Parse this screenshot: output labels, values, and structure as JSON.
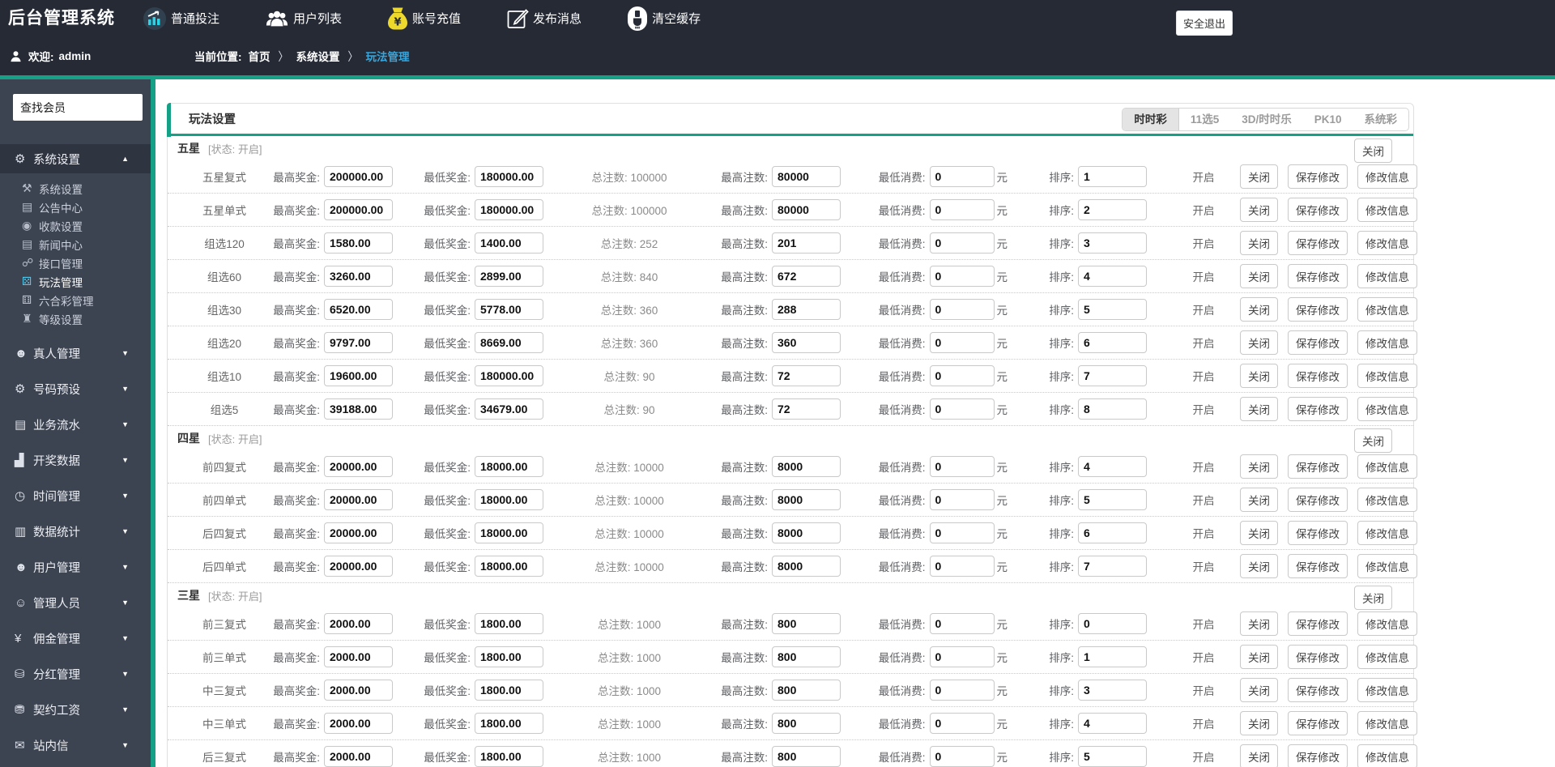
{
  "header": {
    "logo": "后台管理系统",
    "nav": [
      {
        "id": "bet",
        "label": "普通投注",
        "icon": "chart-circle-icon"
      },
      {
        "id": "users",
        "label": "用户列表",
        "icon": "users-icon"
      },
      {
        "id": "recharge",
        "label": "账号充值",
        "icon": "moneybag-icon"
      },
      {
        "id": "message",
        "label": "发布消息",
        "icon": "compose-icon"
      },
      {
        "id": "cache",
        "label": "清空缓存",
        "icon": "brush-icon"
      }
    ],
    "logout_label": "安全退出",
    "welcome_label": "欢迎:",
    "welcome_user": "admin",
    "breadcrumb": {
      "prefix": "当前位置:",
      "sep": "〉",
      "items": [
        "首页",
        "系统设置",
        "玩法管理"
      ]
    }
  },
  "sidebar": {
    "search_placeholder": "查找会员",
    "sections": [
      {
        "label": "系统设置",
        "glyph": "⚙",
        "icon": "gear-icon",
        "expanded": true,
        "children": [
          {
            "label": "系统设置",
            "glyph": "⚒",
            "icon": "wrench-icon"
          },
          {
            "label": "公告中心",
            "glyph": "▤",
            "icon": "notice-doc-icon"
          },
          {
            "label": "收款设置",
            "glyph": "◉",
            "icon": "payment-icon"
          },
          {
            "label": "新闻中心",
            "glyph": "▤",
            "icon": "news-doc-icon"
          },
          {
            "label": "接口管理",
            "glyph": "☍",
            "icon": "interface-icon"
          },
          {
            "label": "玩法管理",
            "glyph": "⚄",
            "icon": "gamepad-icon",
            "active": true
          },
          {
            "label": "六合彩管理",
            "glyph": "⚅",
            "icon": "lhc-gamepad-icon"
          },
          {
            "label": "等级设置",
            "glyph": "♜",
            "icon": "level-icon"
          }
        ]
      },
      {
        "label": "真人管理",
        "glyph": "☻",
        "icon": "live-person-icon"
      },
      {
        "label": "号码预设",
        "glyph": "⚙",
        "icon": "number-preset-icon"
      },
      {
        "label": "业务流水",
        "glyph": "▤",
        "icon": "ledger-icon"
      },
      {
        "label": "开奖数据",
        "glyph": "▟",
        "icon": "draw-data-icon"
      },
      {
        "label": "时间管理",
        "glyph": "◷",
        "icon": "clock-icon"
      },
      {
        "label": "数据统计",
        "glyph": "▥",
        "icon": "stats-icon"
      },
      {
        "label": "用户管理",
        "glyph": "☻",
        "icon": "user-group-icon"
      },
      {
        "label": "管理人员",
        "glyph": "☺",
        "icon": "admin-person-icon"
      },
      {
        "label": "佣金管理",
        "glyph": "¥",
        "icon": "commission-icon"
      },
      {
        "label": "分红管理",
        "glyph": "⛁",
        "icon": "dividend-icon"
      },
      {
        "label": "契约工资",
        "glyph": "⛃",
        "icon": "salary-icon"
      },
      {
        "label": "站内信",
        "glyph": "✉",
        "icon": "mail-icon"
      }
    ]
  },
  "panel": {
    "title": "玩法设置",
    "tabs": [
      {
        "label": "时时彩",
        "active": true
      },
      {
        "label": "11选5"
      },
      {
        "label": "3D/时时乐"
      },
      {
        "label": "PK10"
      },
      {
        "label": "系统彩"
      }
    ]
  },
  "table": {
    "labels": {
      "max_prize": "最高奖金:",
      "min_prize": "最低奖金:",
      "total_bets": "总注数:",
      "max_bets": "最高注数:",
      "min_cost": "最低消费:",
      "yuan": "元",
      "sort": "排序:",
      "status_on": "开启",
      "section_status": "[状态: 开启]",
      "btn_close": "关闭",
      "btn_save": "保存修改",
      "btn_edit": "修改信息"
    },
    "sections": [
      {
        "name": "五星",
        "rows": [
          {
            "name": "五星复式",
            "max_prize": "200000.00",
            "min_prize": "180000.00",
            "total": "100000",
            "max_bets": "80000",
            "min_cost": "0",
            "sort": "1"
          },
          {
            "name": "五星单式",
            "max_prize": "200000.00",
            "min_prize": "180000.00",
            "total": "100000",
            "max_bets": "80000",
            "min_cost": "0",
            "sort": "2"
          },
          {
            "name": "组选120",
            "max_prize": "1580.00",
            "min_prize": "1400.00",
            "total": "252",
            "max_bets": "201",
            "min_cost": "0",
            "sort": "3"
          },
          {
            "name": "组选60",
            "max_prize": "3260.00",
            "min_prize": "2899.00",
            "total": "840",
            "max_bets": "672",
            "min_cost": "0",
            "sort": "4"
          },
          {
            "name": "组选30",
            "max_prize": "6520.00",
            "min_prize": "5778.00",
            "total": "360",
            "max_bets": "288",
            "min_cost": "0",
            "sort": "5"
          },
          {
            "name": "组选20",
            "max_prize": "9797.00",
            "min_prize": "8669.00",
            "total": "360",
            "max_bets": "360",
            "min_cost": "0",
            "sort": "6"
          },
          {
            "name": "组选10",
            "max_prize": "19600.00",
            "min_prize": "180000.00",
            "total": "90",
            "max_bets": "72",
            "min_cost": "0",
            "sort": "7"
          },
          {
            "name": "组选5",
            "max_prize": "39188.00",
            "min_prize": "34679.00",
            "total": "90",
            "max_bets": "72",
            "min_cost": "0",
            "sort": "8"
          }
        ]
      },
      {
        "name": "四星",
        "rows": [
          {
            "name": "前四复式",
            "max_prize": "20000.00",
            "min_prize": "18000.00",
            "total": "10000",
            "max_bets": "8000",
            "min_cost": "0",
            "sort": "4"
          },
          {
            "name": "前四单式",
            "max_prize": "20000.00",
            "min_prize": "18000.00",
            "total": "10000",
            "max_bets": "8000",
            "min_cost": "0",
            "sort": "5"
          },
          {
            "name": "后四复式",
            "max_prize": "20000.00",
            "min_prize": "18000.00",
            "total": "10000",
            "max_bets": "8000",
            "min_cost": "0",
            "sort": "6"
          },
          {
            "name": "后四单式",
            "max_prize": "20000.00",
            "min_prize": "18000.00",
            "total": "10000",
            "max_bets": "8000",
            "min_cost": "0",
            "sort": "7"
          }
        ]
      },
      {
        "name": "三星",
        "rows": [
          {
            "name": "前三复式",
            "max_prize": "2000.00",
            "min_prize": "1800.00",
            "total": "1000",
            "max_bets": "800",
            "min_cost": "0",
            "sort": "0"
          },
          {
            "name": "前三单式",
            "max_prize": "2000.00",
            "min_prize": "1800.00",
            "total": "1000",
            "max_bets": "800",
            "min_cost": "0",
            "sort": "1"
          },
          {
            "name": "中三复式",
            "max_prize": "2000.00",
            "min_prize": "1800.00",
            "total": "1000",
            "max_bets": "800",
            "min_cost": "0",
            "sort": "3"
          },
          {
            "name": "中三单式",
            "max_prize": "2000.00",
            "min_prize": "1800.00",
            "total": "1000",
            "max_bets": "800",
            "min_cost": "0",
            "sort": "4"
          },
          {
            "name": "后三复式",
            "max_prize": "2000.00",
            "min_prize": "1800.00",
            "total": "1000",
            "max_bets": "800",
            "min_cost": "0",
            "sort": "5"
          }
        ]
      }
    ]
  },
  "colors": {
    "teal_accent": "#16a085",
    "header_bg": "#252a35",
    "sidebar_bg": "#3c4351",
    "breadcrumb_active": "#36a6dc",
    "sidebar_active_icon": "#56c5e8",
    "moneybag_yellow": "#ecd92c",
    "chart_icon_cyan": "#29d3e8"
  }
}
